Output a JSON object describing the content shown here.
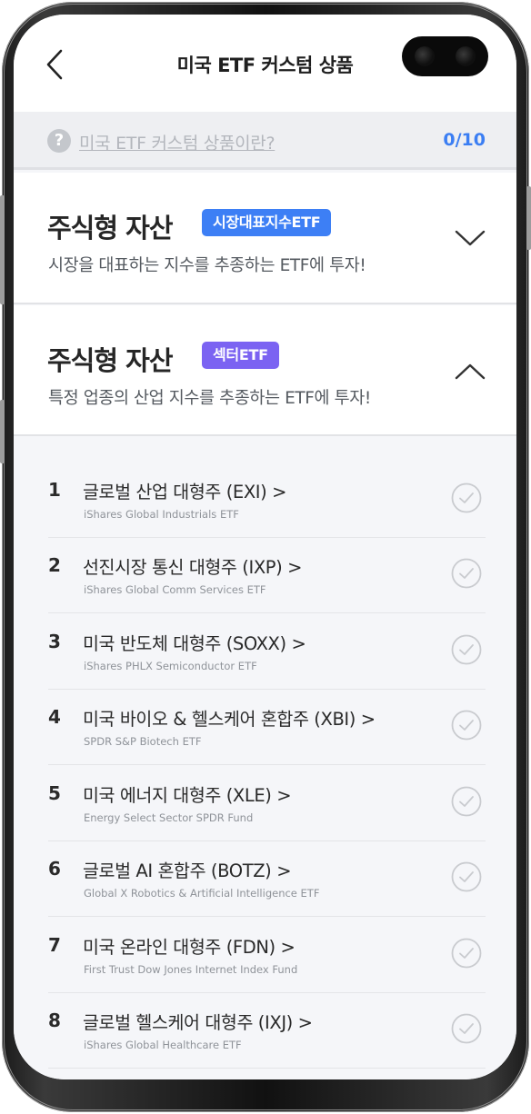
{
  "header": {
    "title": "미국 ETF 커스텀 상품"
  },
  "info": {
    "link": "미국 ETF 커스텀 상품이란?",
    "counter": "0/10"
  },
  "sections": [
    {
      "title": "주식형 자산",
      "badge": "시장대표지수ETF",
      "badge_color": "#3d7ff5",
      "desc": "시장을 대표하는 지수를 추종하는 ETF에 투자!"
    },
    {
      "title": "주식형 자산",
      "badge": "섹터ETF",
      "badge_color": "#7b63f2",
      "desc": "특정 업종의 산업 지수를 추종하는 ETF에 투자!"
    }
  ],
  "items": [
    {
      "num": "1",
      "name": "글로벌 산업 대형주 (EXI) >",
      "sub": "iShares Global Industrials ETF"
    },
    {
      "num": "2",
      "name": "선진시장 통신 대형주 (IXP) >",
      "sub": "iShares Global Comm Services ETF"
    },
    {
      "num": "3",
      "name": "미국 반도체 대형주 (SOXX) >",
      "sub": "iShares PHLX Semiconductor ETF"
    },
    {
      "num": "4",
      "name": "미국 바이오 & 헬스케어 혼합주 (XBI) >",
      "sub": "SPDR S&P Biotech ETF"
    },
    {
      "num": "5",
      "name": "미국 에너지 대형주 (XLE) >",
      "sub": "Energy Select Sector SPDR Fund"
    },
    {
      "num": "6",
      "name": "글로벌 AI 혼합주 (BOTZ) >",
      "sub": "Global X Robotics & Artificial Intelligence ETF"
    },
    {
      "num": "7",
      "name": "미국 온라인 대형주 (FDN) >",
      "sub": "First Trust Dow Jones Internet Index Fund"
    },
    {
      "num": "8",
      "name": "글로벌 헬스케어 대형주 (IXJ) >",
      "sub": "iShares Global Healthcare ETF"
    }
  ]
}
